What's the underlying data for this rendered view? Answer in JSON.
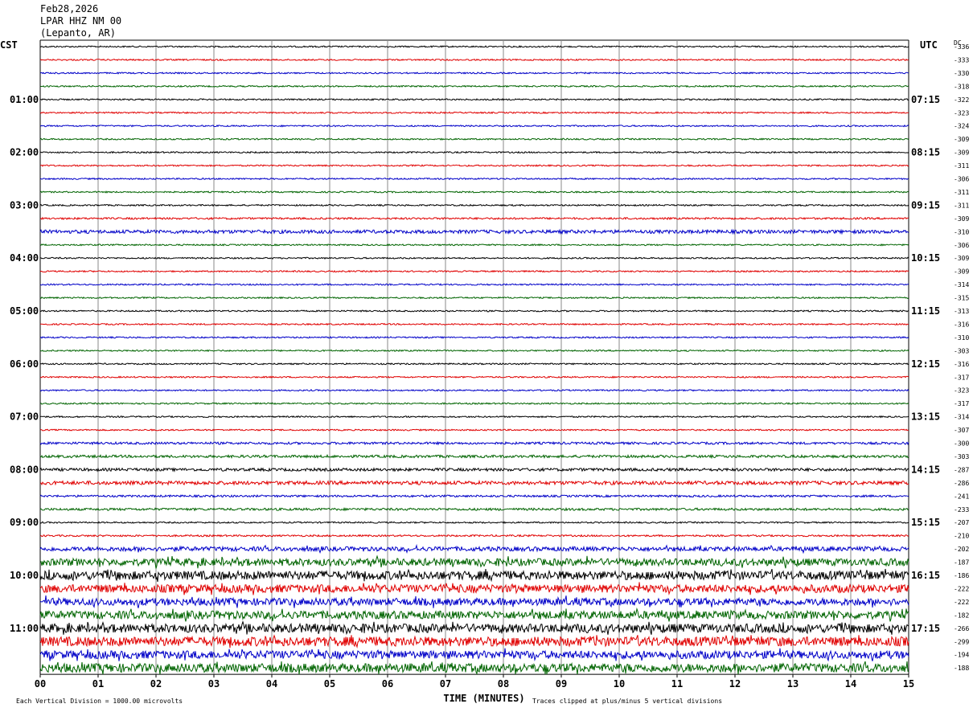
{
  "header": {
    "date": "Feb28,2026",
    "station": "LPAR HHZ NM 00",
    "location": "(Lepanto, AR)"
  },
  "chart_data": {
    "type": "line",
    "title": "",
    "left_zone_label": "CST",
    "right_zone_label": "UTC",
    "dc_label": "DC",
    "xlabel": "TIME (MINUTES)",
    "x_ticks": [
      "00",
      "01",
      "02",
      "03",
      "04",
      "05",
      "06",
      "07",
      "08",
      "09",
      "10",
      "11",
      "12",
      "13",
      "14",
      "15"
    ],
    "xlim": [
      0,
      15
    ],
    "left_time_labels": [
      {
        "row": 4,
        "label": "01:00"
      },
      {
        "row": 8,
        "label": "02:00"
      },
      {
        "row": 12,
        "label": "03:00"
      },
      {
        "row": 16,
        "label": "04:00"
      },
      {
        "row": 20,
        "label": "05:00"
      },
      {
        "row": 24,
        "label": "06:00"
      },
      {
        "row": 28,
        "label": "07:00"
      },
      {
        "row": 32,
        "label": "08:00"
      },
      {
        "row": 36,
        "label": "09:00"
      },
      {
        "row": 40,
        "label": "10:00"
      },
      {
        "row": 44,
        "label": "11:00"
      }
    ],
    "right_time_labels": [
      {
        "row": 4,
        "label": "07:15"
      },
      {
        "row": 8,
        "label": "08:15"
      },
      {
        "row": 12,
        "label": "09:15"
      },
      {
        "row": 16,
        "label": "10:15"
      },
      {
        "row": 20,
        "label": "11:15"
      },
      {
        "row": 24,
        "label": "12:15"
      },
      {
        "row": 28,
        "label": "13:15"
      },
      {
        "row": 32,
        "label": "14:15"
      },
      {
        "row": 36,
        "label": "15:15"
      },
      {
        "row": 40,
        "label": "16:15"
      },
      {
        "row": 44,
        "label": "17:15"
      }
    ],
    "dc_offsets": [
      "-336",
      "-333",
      "-330",
      "-318",
      "-322",
      "-323",
      "-324",
      "-309",
      "-309",
      "-311",
      "-306",
      "-311",
      "-311",
      "-309",
      "-310",
      "-306",
      "-309",
      "-309",
      "-314",
      "-315",
      "-313",
      "-316",
      "-310",
      "-303",
      "-316",
      "-317",
      "-323",
      "-317",
      "-314",
      "-307",
      "-300",
      "-303",
      "-287",
      "-286",
      "-241",
      "-233",
      "-207",
      "-210",
      "-202",
      "-187",
      "-186",
      "-222",
      "-222",
      "-182",
      "-266",
      "-299",
      "-194",
      "-188"
    ],
    "trace_colors": [
      "#000000",
      "#e00000",
      "#0000c8",
      "#006400"
    ],
    "trace_amplitude": [
      1,
      1,
      1,
      1,
      1,
      1,
      1,
      1,
      1,
      1,
      1,
      1,
      1,
      1.3,
      2.4,
      1,
      1,
      1,
      1,
      1,
      1,
      1,
      1,
      1,
      1,
      1,
      1,
      1,
      1,
      1,
      1.6,
      1.8,
      2,
      2.5,
      1.4,
      1.6,
      1,
      1.2,
      3,
      5,
      6,
      5.5,
      5,
      5.5,
      6,
      6.5,
      5.5,
      6
    ],
    "footer_left": "Each Vertical Division = 1000.00 microvolts",
    "footer_right": "Traces clipped at plus/minus 5 vertical divisions",
    "grid": true
  }
}
